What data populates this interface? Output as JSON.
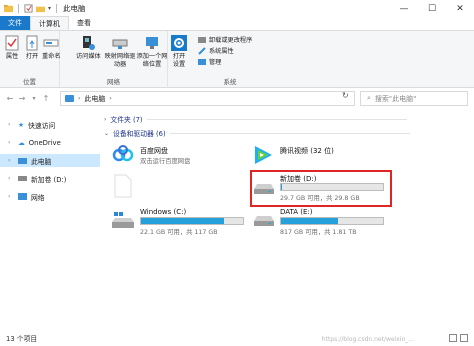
{
  "window": {
    "title": "此电脑",
    "controls": {
      "minimize": "—",
      "maximize": "☐",
      "close": "✕"
    }
  },
  "ribbon_tabs": [
    {
      "label": "文件"
    },
    {
      "label": "计算机"
    },
    {
      "label": "查看"
    }
  ],
  "ribbon": {
    "location_group": {
      "label": "位置",
      "buttons": [
        "属性",
        "打开",
        "重命名"
      ]
    },
    "network_group": {
      "label": "网络",
      "buttons": [
        "访问媒体",
        "映射网络驱动器",
        "添加一个网络位置"
      ]
    },
    "system_group": {
      "label": "系统",
      "open_settings": "打开设置",
      "small_buttons": [
        "卸载或更改程序",
        "系统属性",
        "管理"
      ]
    }
  },
  "address": {
    "path": "此电脑",
    "search_placeholder": "搜索\"此电脑\""
  },
  "nav_pane": [
    {
      "label": "快速访问",
      "selected": false
    },
    {
      "label": "OneDrive",
      "selected": false
    },
    {
      "label": "此电脑",
      "selected": true
    },
    {
      "label": "新加卷 (D:)",
      "selected": false
    },
    {
      "label": "网络",
      "selected": false
    }
  ],
  "sections": {
    "folders": "文件夹 (7)",
    "devices": "设备和驱动器 (6)"
  },
  "devices": {
    "baidu": {
      "name": "百度网盘",
      "sub": "双击运行百度网盘"
    },
    "tencent": {
      "name": "腾讯视频 (32 位)"
    },
    "new_volume": {
      "name": "新加卷 (D:)",
      "sub": "29.7 GB 可用，共 29.8 GB",
      "used_fraction": 0.01
    },
    "windows_c": {
      "name": "Windows (C:)",
      "sub": "22.1 GB 可用，共 117 GB",
      "used_fraction": 0.81
    },
    "data_e": {
      "name": "DATA (E:)",
      "sub": "817 GB 可用，共 1.81 TB",
      "used_fraction": 0.56
    }
  },
  "status": {
    "count": "13 个项目",
    "watermark": "https://blog.csdn.net/weixin_..."
  },
  "colors": {
    "file_tab": "#1979ca",
    "bar_fill": "#26a0da",
    "highlight": "#e02525",
    "selected_nav": "#cce8ff"
  }
}
